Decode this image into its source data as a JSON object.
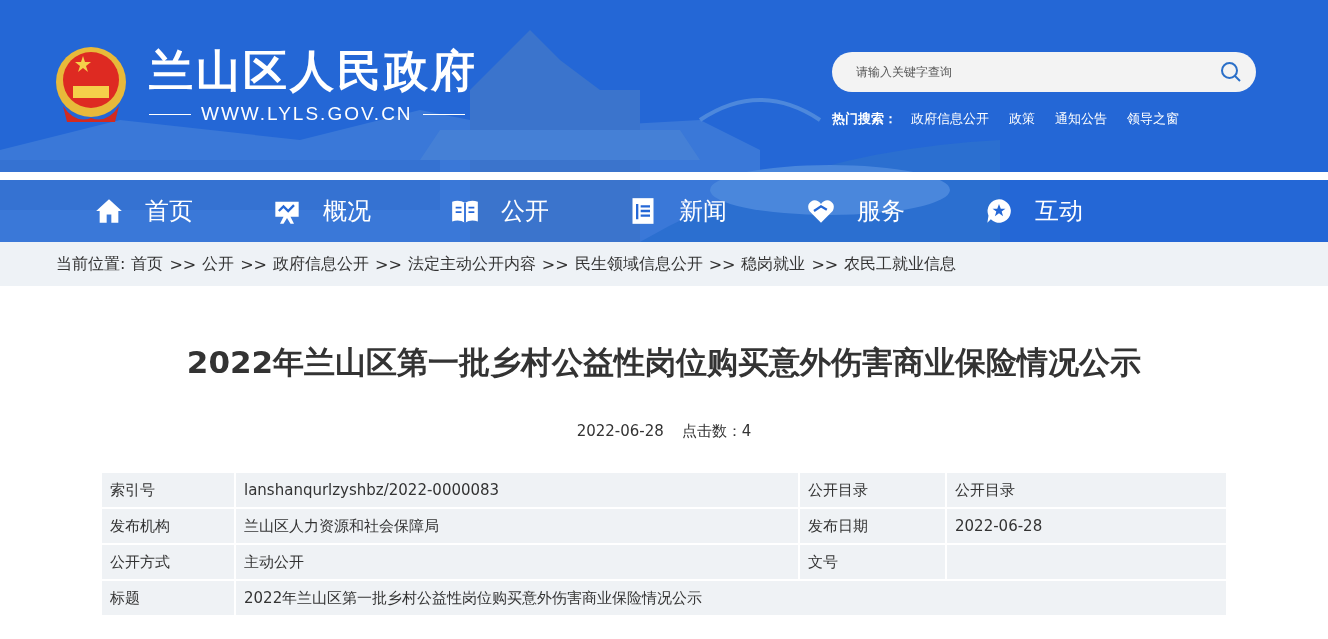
{
  "header": {
    "site_name": "兰山区人民政府",
    "site_url": "WWW.LYLS.GOV.CN",
    "search": {
      "placeholder": "请输入关键字查询"
    },
    "hot_search": {
      "label": "热门搜索：",
      "links": [
        "政府信息公开",
        "政策",
        "通知公告",
        "领导之窗"
      ]
    }
  },
  "nav": [
    {
      "label": "首页"
    },
    {
      "label": "概况"
    },
    {
      "label": "公开"
    },
    {
      "label": "新闻"
    },
    {
      "label": "服务"
    },
    {
      "label": "互动"
    }
  ],
  "breadcrumb": {
    "label": "当前位置:",
    "items": [
      {
        "text": "首页",
        "separator": ">>"
      },
      {
        "text": "公开",
        "separator": ">>"
      },
      {
        "text": "政府信息公开",
        "separator": ">>"
      },
      {
        "text": "法定主动公开内容",
        "separator": ">>"
      },
      {
        "text": "民生领域信息公开",
        "separator": ">>"
      },
      {
        "text": "稳岗就业",
        "separator": ">>"
      },
      {
        "text": "农民工就业信息"
      }
    ]
  },
  "article": {
    "title": "2022年兰山区第一批乡村公益性岗位购买意外伤害商业保险情况公示",
    "date": "2022-06-28",
    "clicks": "点击数：4"
  },
  "info_table": {
    "rows": [
      {
        "cells": [
          {
            "kind": "label",
            "text": "索引号"
          },
          {
            "kind": "value",
            "text": "lanshanqurlzyshbz/2022-0000083"
          },
          {
            "kind": "label",
            "text": "公开目录"
          },
          {
            "kind": "value",
            "text": "公开目录"
          }
        ]
      },
      {
        "cells": [
          {
            "kind": "label",
            "text": "发布机构"
          },
          {
            "kind": "value",
            "text": "兰山区人力资源和社会保障局"
          },
          {
            "kind": "label",
            "text": "发布日期"
          },
          {
            "kind": "value",
            "text": "2022-06-28"
          }
        ]
      },
      {
        "cells": [
          {
            "kind": "label",
            "text": "公开方式"
          },
          {
            "kind": "value",
            "text": "主动公开"
          },
          {
            "kind": "label",
            "text": "文号"
          },
          {
            "kind": "empty"
          }
        ]
      },
      {
        "cells": [
          {
            "kind": "label",
            "text": "标题"
          },
          {
            "kind": "value",
            "colspan": 3,
            "text": "2022年兰山区第一批乡村公益性岗位购买意外伤害商业保险情况公示"
          }
        ]
      }
    ]
  }
}
